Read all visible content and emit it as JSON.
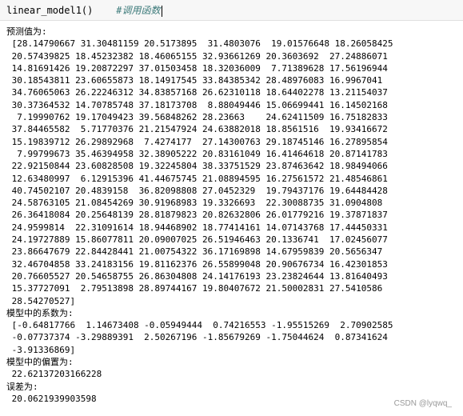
{
  "cell": {
    "code": "linear_model1()",
    "comment": "#调用函数"
  },
  "output": {
    "pred_label": "预测值为:",
    "pred_lines": [
      " [28.14790667 31.30481159 20.5173895  31.4803076  19.01576648 18.26058425",
      " 20.57439825 18.45232382 18.46065155 32.93661269 20.3603692  27.24886071",
      " 14.81691426 19.20872297 37.01503458 18.32036009  7.71389628 17.56196944",
      " 30.18543811 23.60655873 18.14917545 33.84385342 28.48976083 16.9967041",
      " 34.76065063 26.22246312 34.83857168 26.62310118 18.64402278 13.21154037",
      " 30.37364532 14.70785748 37.18173708  8.88049446 15.06699441 16.14502168",
      "  7.19990762 19.17049423 39.56848262 28.23663    24.62411509 16.75182833",
      " 37.84465582  5.71770376 21.21547924 24.63882018 18.8561516  19.93416672",
      " 15.19839712 26.29892968  7.4274177  27.14300763 29.18745146 16.27895854",
      "  7.99799673 35.46394958 32.38905222 20.83161049 16.41464618 20.87141783",
      " 22.92150844 23.60828508 19.32245804 38.33751529 23.87463642 18.98494066",
      " 12.63480997  6.12915396 41.44675745 21.08894595 16.27561572 21.48546861",
      " 40.74502107 20.4839158  36.82098808 27.0452329  19.79437176 19.64484428",
      " 24.58763105 21.08454269 30.91968983 19.3326693  22.30088735 31.0904808",
      " 26.36418084 20.25648139 28.81879823 20.82632806 26.01779216 19.37871837",
      " 24.9599814  22.31091614 18.94468902 18.77414161 14.07143768 17.44450331",
      " 24.19727889 15.86077811 20.09007025 26.51946463 20.1336741  17.02456077",
      " 23.86647679 22.84428441 21.00754322 36.17169898 14.67959839 20.5656347",
      " 32.46704858 33.24183156 19.81162376 26.55899048 20.90676734 16.42301853",
      " 20.76605527 20.54658755 26.86304808 24.14176193 23.23824644 13.81640493",
      " 15.37727091  2.79513898 28.89744167 19.80407672 21.50002831 27.5410586",
      " 28.54270527]"
    ],
    "coef_label": "模型中的系数为:",
    "coef_lines": [
      " [-0.64817766  1.14673408 -0.05949444  0.74216553 -1.95515269  2.70902585",
      " -0.07737374 -3.29889391  2.50267196 -1.85679269 -1.75044624  0.87341624",
      " -3.91336869]"
    ],
    "intercept_label": "模型中的偏置为:",
    "intercept_value": " 22.62137203166228",
    "error_label": "误差为:",
    "error_value": " 20.0621939903598"
  },
  "watermark": "CSDN @lyqwq_"
}
